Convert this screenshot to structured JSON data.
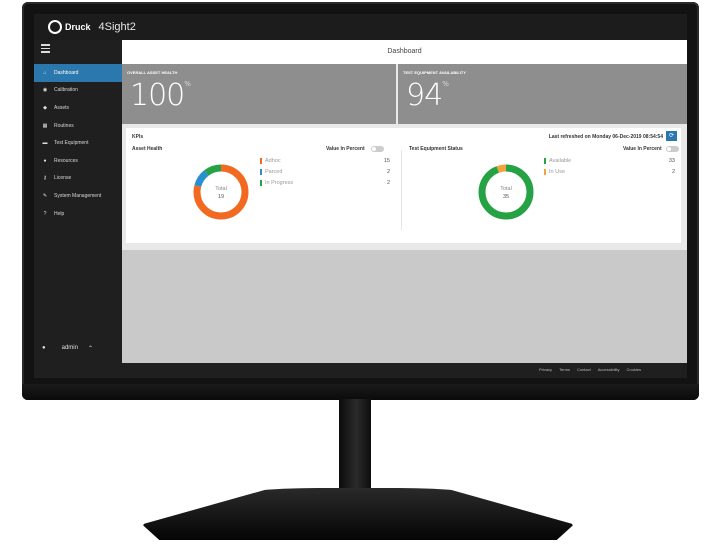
{
  "app": {
    "brand": "Druck",
    "name": "4Sight2"
  },
  "page_title": "Dashboard",
  "nav": [
    {
      "label": "Dashboard",
      "icon": "home-icon",
      "glyph": "⌂",
      "active": true
    },
    {
      "label": "Calibration",
      "icon": "calibration-icon",
      "glyph": "◉",
      "active": false
    },
    {
      "label": "Assets",
      "icon": "tag-icon",
      "glyph": "◆",
      "active": false
    },
    {
      "label": "Routines",
      "icon": "calendar-icon",
      "glyph": "▦",
      "active": false
    },
    {
      "label": "Test Equipment",
      "icon": "equipment-icon",
      "glyph": "▬",
      "active": false
    },
    {
      "label": "Resources",
      "icon": "user-icon",
      "glyph": "●",
      "active": false
    },
    {
      "label": "License",
      "icon": "key-icon",
      "glyph": "⚷",
      "active": false
    },
    {
      "label": "System Management",
      "icon": "wrench-icon",
      "glyph": "✎",
      "active": false
    },
    {
      "label": "Help",
      "icon": "help-icon",
      "glyph": "?",
      "active": false
    }
  ],
  "user": {
    "name": "admin"
  },
  "stats": {
    "asset_health": {
      "label": "OVERALL ASSET HEALTH",
      "value": "100",
      "unit": "%"
    },
    "equipment_availability": {
      "label": "TEST EQUIPMENT AVAILABILITY",
      "value": "94",
      "unit": "%"
    }
  },
  "kpis": {
    "title": "KPIs",
    "last_refreshed": "Last refreshed on Monday 06-Dec-2019 08:54:54",
    "toggle_label": "Value In Percent",
    "asset_health": {
      "title": "Asset Health",
      "total_label": "Total",
      "total": "19",
      "legend": [
        {
          "label": "Adhoc",
          "value": "15",
          "color": "#f26a22"
        },
        {
          "label": "Parced",
          "value": "2",
          "color": "#2a8fd0"
        },
        {
          "label": "In Progress",
          "value": "2",
          "color": "#25a244"
        }
      ]
    },
    "equipment_status": {
      "title": "Test Equipment Status",
      "total_label": "Total",
      "total": "35",
      "legend": [
        {
          "label": "Available",
          "value": "33",
          "color": "#25a244"
        },
        {
          "label": "In Use",
          "value": "2",
          "color": "#f2a43c"
        }
      ]
    }
  },
  "footer": [
    "Privacy",
    "Terms",
    "Contact",
    "Accessibility",
    "Cookies"
  ]
}
